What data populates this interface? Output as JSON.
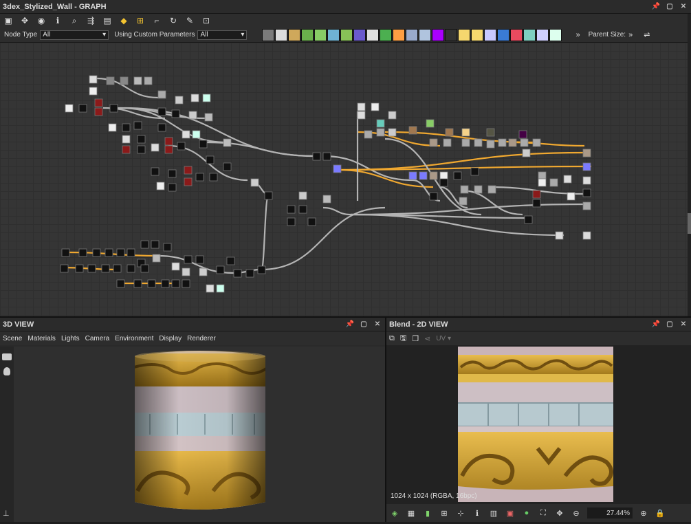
{
  "graph_panel": {
    "title": "3dex_Stylized_Wall - GRAPH",
    "toolbar_icons": [
      "fit-icon",
      "pan-icon",
      "camera-icon",
      "info-icon",
      "search-icon",
      "flow-icon",
      "frame-icon",
      "python-icon",
      "layout-icon",
      "connect-icon",
      "refresh-icon",
      "tools-icon",
      "export-icon"
    ],
    "node_type_label": "Node Type",
    "node_type_value": "All",
    "custom_params_label": "Using Custom Parameters",
    "custom_params_value": "All",
    "parent_size_label": "Parent Size:",
    "more_label": "»",
    "colors": {
      "orange_link": "#f0a830",
      "gray_link": "#b4b4b4",
      "canvas_bg": "#353535"
    }
  },
  "view3d": {
    "title": "3D VIEW",
    "menu": [
      "Scene",
      "Materials",
      "Lights",
      "Camera",
      "Environment",
      "Display",
      "Renderer"
    ]
  },
  "view2d": {
    "title": "Blend - 2D VIEW",
    "uv_label": "UV",
    "resolution_text": "1024 x 1024 (RGBA, 16bpc)",
    "zoom_value": "27.44%"
  },
  "colors": {
    "gold": "#c99a2e",
    "stone": "#d4c3c6",
    "tile": "#a9c0c8"
  }
}
